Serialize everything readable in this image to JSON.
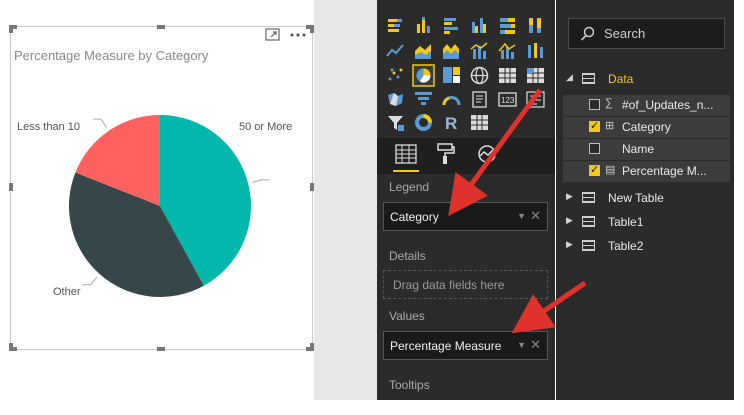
{
  "chart": {
    "title": "Percentage Measure by Category",
    "labels": [
      "50 or More",
      "Less than 10",
      "Other"
    ]
  },
  "chart_data": {
    "type": "pie",
    "title": "Percentage Measure by Category",
    "categories": [
      "50 or More",
      "Other",
      "Less than 10"
    ],
    "values": [
      42,
      39,
      19
    ],
    "colors": [
      "#01b8aa",
      "#374649",
      "#fd625e"
    ]
  },
  "viz_pane": {
    "sections": {
      "legend": "Legend",
      "details": "Details",
      "values": "Values",
      "tooltips": "Tooltips"
    },
    "wells": {
      "legend_field": "Category",
      "details_placeholder": "Drag data fields here",
      "values_field": "Percentage Measure"
    }
  },
  "fields_pane": {
    "search_placeholder": "Search",
    "tables": [
      {
        "name": "Data",
        "expanded": true,
        "active": true
      },
      {
        "name": "New Table"
      },
      {
        "name": "Table1"
      },
      {
        "name": "Table2"
      }
    ],
    "fields": [
      {
        "name": "#of_Updates_n...",
        "icon": "sigma-icon",
        "checked": false
      },
      {
        "name": "Category",
        "icon": "hierarchy-icon",
        "checked": true
      },
      {
        "name": "Name",
        "icon": "",
        "checked": false
      },
      {
        "name": "Percentage M...",
        "icon": "calculator-icon",
        "checked": true
      }
    ]
  },
  "colors": {
    "accent_yellow": "#f2c811",
    "arrow_red": "#e0322c",
    "pane_bg": "#2b2b2b"
  }
}
